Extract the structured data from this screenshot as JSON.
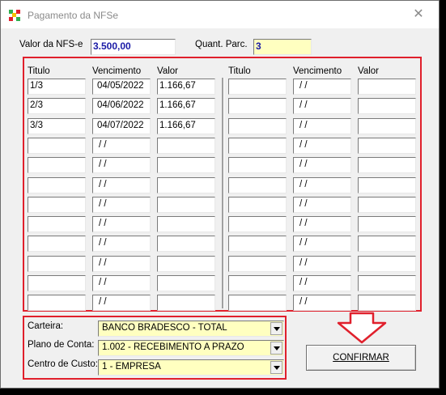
{
  "window": {
    "title": "Pagamento da NFSe",
    "close_icon": "close-icon"
  },
  "header": {
    "valor_label": "Valor da NFS-e",
    "valor_value": "3.500,00",
    "parc_label": "Quant. Parc.",
    "parc_value": "3"
  },
  "columns": {
    "titulo": "Titulo",
    "vencimento": "Vencimento",
    "valor": "Valor"
  },
  "installments_left": [
    {
      "titulo": "1/3",
      "vencimento": "04/05/2022",
      "valor": "1.166,67"
    },
    {
      "titulo": "2/3",
      "vencimento": "04/06/2022",
      "valor": "1.166,67"
    },
    {
      "titulo": "3/3",
      "vencimento": "04/07/2022",
      "valor": "1.166,67"
    },
    {
      "titulo": "",
      "vencimento": " / /",
      "valor": ""
    },
    {
      "titulo": "",
      "vencimento": " / /",
      "valor": ""
    },
    {
      "titulo": "",
      "vencimento": " / /",
      "valor": ""
    },
    {
      "titulo": "",
      "vencimento": " / /",
      "valor": ""
    },
    {
      "titulo": "",
      "vencimento": " / /",
      "valor": ""
    },
    {
      "titulo": "",
      "vencimento": " / /",
      "valor": ""
    },
    {
      "titulo": "",
      "vencimento": " / /",
      "valor": ""
    },
    {
      "titulo": "",
      "vencimento": " / /",
      "valor": ""
    },
    {
      "titulo": "",
      "vencimento": " / /",
      "valor": ""
    }
  ],
  "installments_right": [
    {
      "titulo": "",
      "vencimento": " / /",
      "valor": ""
    },
    {
      "titulo": "",
      "vencimento": " / /",
      "valor": ""
    },
    {
      "titulo": "",
      "vencimento": " / /",
      "valor": ""
    },
    {
      "titulo": "",
      "vencimento": " / /",
      "valor": ""
    },
    {
      "titulo": "",
      "vencimento": " / /",
      "valor": ""
    },
    {
      "titulo": "",
      "vencimento": " / /",
      "valor": ""
    },
    {
      "titulo": "",
      "vencimento": " / /",
      "valor": ""
    },
    {
      "titulo": "",
      "vencimento": " / /",
      "valor": ""
    },
    {
      "titulo": "",
      "vencimento": " / /",
      "valor": ""
    },
    {
      "titulo": "",
      "vencimento": " / /",
      "valor": ""
    },
    {
      "titulo": "",
      "vencimento": " / /",
      "valor": ""
    },
    {
      "titulo": "",
      "vencimento": " / /",
      "valor": ""
    }
  ],
  "footer": {
    "carteira_label": "Carteira:",
    "carteira_value": "BANCO BRADESCO - TOTAL",
    "plano_label": "Plano de Conta:",
    "plano_value": "1.002 - RECEBIMENTO A PRAZO",
    "centro_label": "Centro de Custo:",
    "centro_value": "1 - EMPRESA",
    "confirm_label": "CONFIRMAR"
  },
  "colors": {
    "highlight_red": "#e0202c",
    "field_yellow": "#ffffc0",
    "value_blue": "#1a1aa6"
  }
}
